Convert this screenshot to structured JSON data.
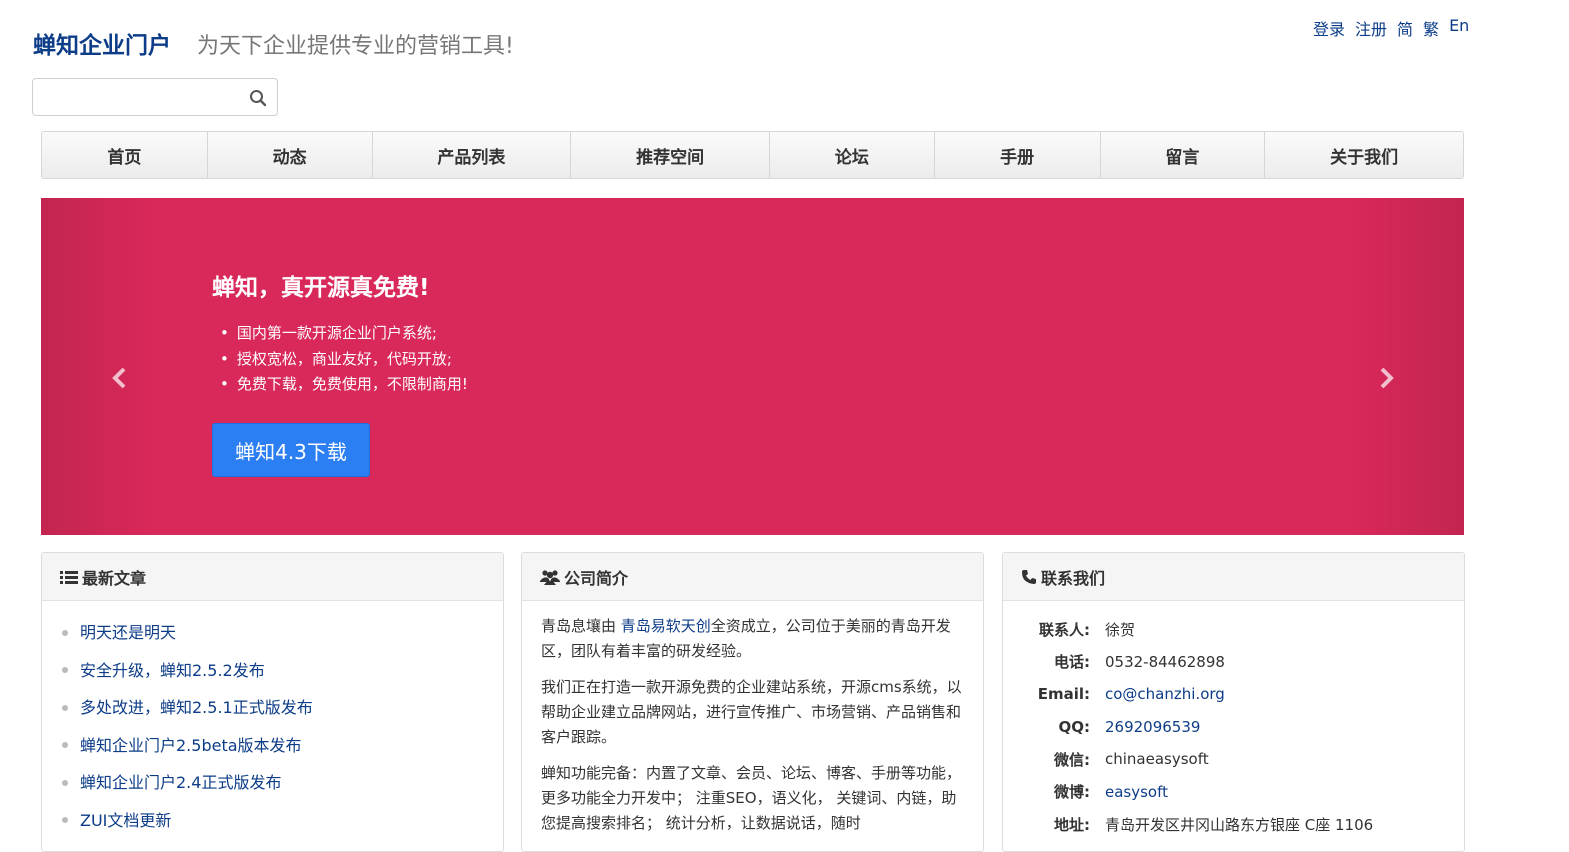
{
  "header": {
    "brand": "蝉知企业门户",
    "slogan": "为天下企业提供专业的营销工具!",
    "links": [
      "登录",
      "注册",
      "简",
      "繁",
      "En"
    ]
  },
  "search": {
    "placeholder": "",
    "value": "",
    "icon": "search-icon"
  },
  "nav": {
    "items": [
      "首页",
      "动态",
      "产品列表",
      "推荐空间",
      "论坛",
      "手册",
      "留言",
      "关于我们"
    ]
  },
  "banner": {
    "title": "蝉知，真开源真免费!",
    "points": [
      "国内第一款开源企业门户系统;",
      "授权宽松，商业友好，代码开放;",
      "免费下载，免费使用，不限制商用!"
    ],
    "button": "蝉知4.3下载",
    "background_color": "#d9285a"
  },
  "articles": {
    "title": "最新文章",
    "items": [
      "明天还是明天",
      "安全升级，蝉知2.5.2发布",
      "多处改进，蝉知2.5.1正式版发布",
      "蝉知企业门户2.5beta版本发布",
      "蝉知企业门户2.4正式版发布",
      "ZUI文档更新"
    ]
  },
  "company": {
    "title": "公司简介",
    "p1_before": "青岛息壤由 ",
    "p1_link": "青岛易软天创",
    "p1_after": "全资成立，公司位于美丽的青岛开发区，团队有着丰富的研发经验。",
    "p2": "我们正在打造一款开源免费的企业建站系统，开源cms系统，以帮助企业建立品牌网站，进行宣传推广、市场营销、产品销售和客户跟踪。",
    "p3": "蝉知功能完备：内置了文章、会员、论坛、博客、手册等功能，更多功能全力开发中； 注重SEO，语义化， 关键词、内链，助您提高搜索排名； 统计分析，让数据说话，随时"
  },
  "contact": {
    "title": "联系我们",
    "rows": [
      {
        "label": "联系人:",
        "value": "徐贺"
      },
      {
        "label": "电话:",
        "value": "0532-84462898"
      },
      {
        "label": "Email:",
        "value": "co@chanzhi.org"
      },
      {
        "label": "QQ:",
        "value": "2692096539"
      },
      {
        "label": "微信:",
        "value": "chinaeasysoft"
      },
      {
        "label": "微博:",
        "value": "easysoft"
      },
      {
        "label": "地址:",
        "value": "青岛开发区井冈山路东方银座 C座 1106"
      }
    ]
  }
}
